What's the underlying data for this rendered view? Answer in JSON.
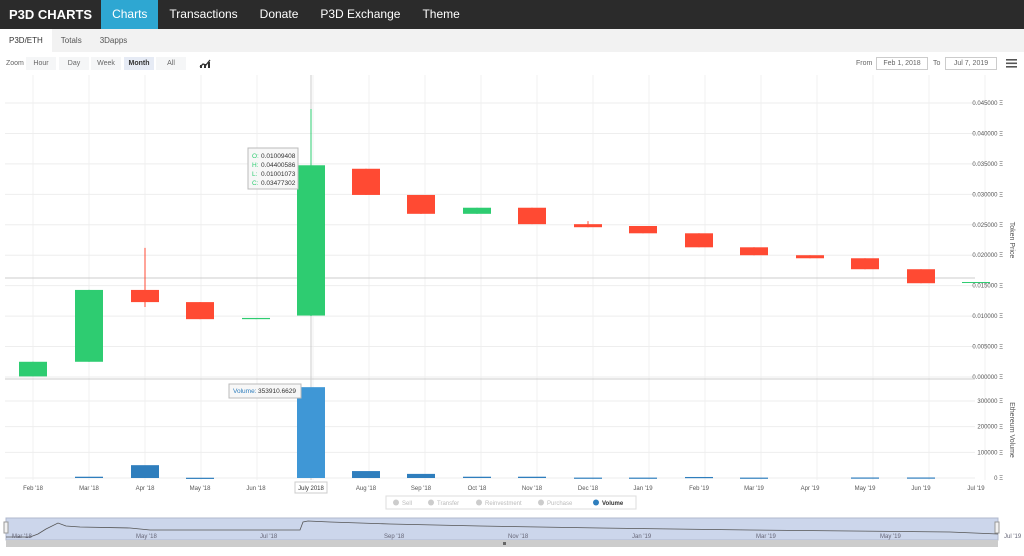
{
  "nav": {
    "brand": "P3D CHARTS",
    "items": [
      "Charts",
      "Transactions",
      "Donate",
      "P3D Exchange",
      "Theme"
    ],
    "active": 0
  },
  "tabs": {
    "items": [
      "P3D/ETH",
      "Totals",
      "3Dapps"
    ],
    "active": 0
  },
  "toolbar": {
    "zoom_label": "Zoom",
    "buttons": [
      "Hour",
      "Day",
      "Week",
      "Month",
      "All"
    ],
    "active": "Month",
    "from_label": "From",
    "from_value": "Feb 1, 2018",
    "to_label": "To",
    "to_value": "Jul 7, 2019",
    "menu_icon": "hamburger-icon",
    "indicator_icon": "chart-indicator-icon"
  },
  "colors": {
    "up": "#2ecc71",
    "down": "#ff4a33",
    "volume": "#2f7ebd",
    "nav_active": "#2ea7d2"
  },
  "chart_data": {
    "type": "candlestick",
    "categories": [
      "Feb '18",
      "Mar '18",
      "Apr '18",
      "May '18",
      "Jun '18",
      "July 2018",
      "Aug '18",
      "Sep '18",
      "Oct '18",
      "Nov '18",
      "Dec '18",
      "Jan '19",
      "Feb '19",
      "Mar '19",
      "Apr '19",
      "May '19",
      "Jun '19",
      "Jul '19"
    ],
    "ohlc": [
      [
        0.0001,
        0.0025,
        0.0001,
        0.0025
      ],
      [
        0.0025,
        0.0143,
        0.0025,
        0.0143
      ],
      [
        0.0143,
        0.0212,
        0.0115,
        0.0123
      ],
      [
        0.0123,
        0.0123,
        0.0095,
        0.0095
      ],
      [
        0.0095,
        0.0097,
        0.0095,
        0.0097
      ],
      [
        0.01009408,
        0.04400586,
        0.01001073,
        0.03477302
      ],
      [
        0.0342,
        0.0342,
        0.0299,
        0.0299
      ],
      [
        0.0299,
        0.0299,
        0.0268,
        0.0268
      ],
      [
        0.0268,
        0.0278,
        0.0268,
        0.0278
      ],
      [
        0.0278,
        0.0278,
        0.0251,
        0.0251
      ],
      [
        0.0251,
        0.0256,
        0.0246,
        0.0246
      ],
      [
        0.0248,
        0.0248,
        0.0236,
        0.0236
      ],
      [
        0.0236,
        0.0236,
        0.0213,
        0.0213
      ],
      [
        0.0213,
        0.0213,
        0.02,
        0.02
      ],
      [
        0.02,
        0.02,
        0.0195,
        0.0195
      ],
      [
        0.0195,
        0.0195,
        0.0177,
        0.0177
      ],
      [
        0.0177,
        0.0177,
        0.0154,
        0.0154
      ],
      [
        0.0155,
        0.0156,
        0.0155,
        0.0156
      ]
    ],
    "volume": [
      0,
      5000,
      50000,
      1000,
      0,
      353910.6629,
      27000,
      16000,
      5000,
      5000,
      1500,
      1500,
      4000,
      1500,
      0,
      2000,
      2000,
      0
    ],
    "price_axis": {
      "label": "Token Price",
      "ticks": [
        "0.000000 Ξ",
        "0.005000 Ξ",
        "0.010000 Ξ",
        "0.015000 Ξ",
        "0.020000 Ξ",
        "0.025000 Ξ",
        "0.030000 Ξ",
        "0.035000 Ξ",
        "0.040000 Ξ",
        "0.045000 Ξ"
      ],
      "range": [
        0,
        0.045
      ]
    },
    "volume_axis": {
      "label": "Ethereum Volume",
      "ticks": [
        "0 Ξ",
        "100000 Ξ",
        "200000 Ξ",
        "300000 Ξ"
      ],
      "range": [
        0,
        300000
      ]
    },
    "tooltip": {
      "o": "0.01009408",
      "h": "0.04400586",
      "l": "0.01001073",
      "c": "0.03477302",
      "volume_label": "Volume:",
      "volume_value": "353910.6629"
    },
    "legend": {
      "items": [
        "Sell",
        "Transfer",
        "Reinvestment",
        "Purchase",
        "Volume"
      ],
      "active": "Volume"
    },
    "navigator": {
      "labels": [
        "Mar '18",
        "May '18",
        "Jul '18",
        "Sep '18",
        "Nov '18",
        "Jan '19",
        "Mar '19",
        "May '19",
        "Jul '19"
      ]
    }
  }
}
